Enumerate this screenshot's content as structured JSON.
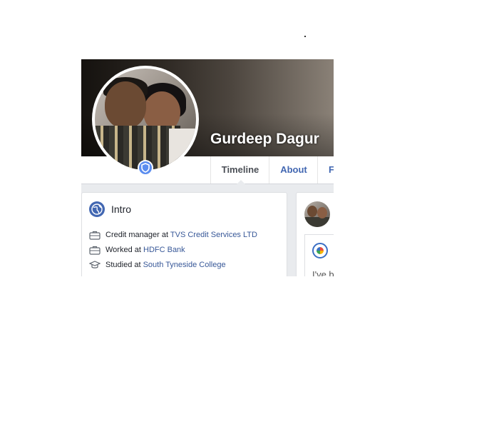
{
  "profile": {
    "name": "Gurdeep Dagur"
  },
  "nav": {
    "tabs": [
      {
        "label": "Timeline"
      },
      {
        "label": "About"
      },
      {
        "label": "F"
      }
    ]
  },
  "intro": {
    "title": "Intro",
    "items": [
      {
        "prefix": "Credit manager at ",
        "link": "TVS Credit Services LTD",
        "icon": "briefcase-icon"
      },
      {
        "prefix": "Worked at ",
        "link": "HDFC Bank",
        "icon": "briefcase-icon"
      },
      {
        "prefix": "Studied at ",
        "link": "South Tyneside College",
        "icon": "graduation-cap-icon"
      }
    ]
  },
  "post": {
    "snippet": "I've b"
  },
  "colors": {
    "link": "#385898",
    "nav_active": "#4b4f56",
    "nav_tab": "#4267b2",
    "intro_icon_bg": "#4267b2",
    "badge": "#5b8def"
  }
}
